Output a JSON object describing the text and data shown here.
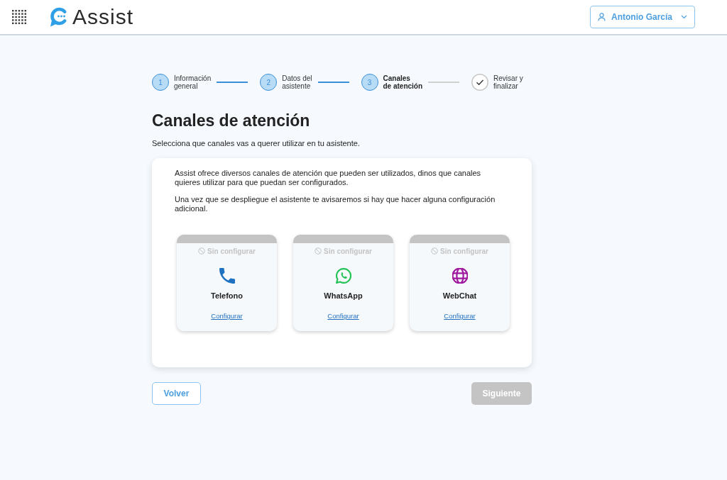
{
  "header": {
    "logo_text": "Assist",
    "user": {
      "name": "Antonio García"
    }
  },
  "stepper": {
    "steps": [
      {
        "kind": "number",
        "number": "1",
        "label_lines": [
          "Información",
          "general"
        ],
        "done": true,
        "selected": false
      },
      {
        "kind": "number",
        "number": "2",
        "label_lines": [
          "Datos del",
          "asistente"
        ],
        "done": true,
        "selected": false
      },
      {
        "kind": "number",
        "number": "3",
        "label_lines": [
          "Canales",
          "de atención"
        ],
        "done": false,
        "selected": true
      },
      {
        "kind": "check",
        "label_lines": [
          "Revisar y",
          "finalizar"
        ],
        "done": false,
        "selected": false
      }
    ]
  },
  "page": {
    "title": "Canales de atención",
    "subtitle": "Selecciona que canales vas a querer utilizar en tu asistente."
  },
  "panel": {
    "paragraphs": [
      "Assist ofrece diversos canales de atención que pueden ser utilizados, dinos que canales quieres utilizar para que puedan ser configurados.",
      "Una vez que se despliegue el asistente te avisaremos si hay que hacer alguna configuración adicional."
    ],
    "channels": [
      {
        "kind": "phone",
        "name": "Telefono",
        "color": "#1f72c2",
        "configured": false,
        "status": "Sin configurar",
        "action": "Configurar"
      },
      {
        "kind": "whatsapp",
        "name": "WhatsApp",
        "color": "#27c35a",
        "configured": false,
        "status": "Sin configurar",
        "action": "Configurar"
      },
      {
        "kind": "web",
        "name": "WebChat",
        "color": "#a0189e",
        "configured": false,
        "status": "Sin configurar",
        "action": "Configurar"
      }
    ]
  },
  "buttons": {
    "back": {
      "label": "Volver"
    },
    "next": {
      "label": "Siguiente",
      "disabled": true
    }
  }
}
